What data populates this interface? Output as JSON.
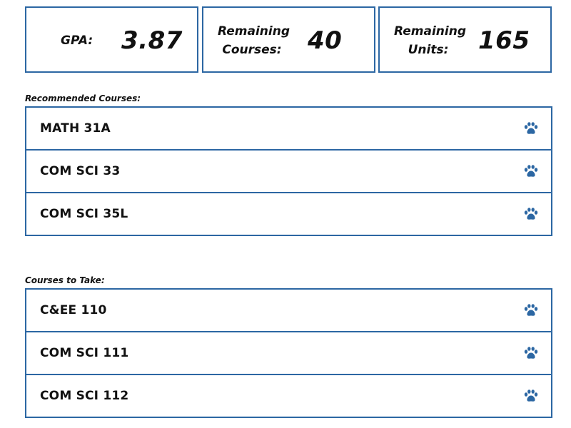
{
  "stats": {
    "gpa": {
      "label": "GPA:",
      "value": "3.87"
    },
    "remaining_courses": {
      "label": "Remaining Courses:",
      "value": "40"
    },
    "remaining_units": {
      "label": "Remaining Units:",
      "value": "165"
    }
  },
  "recommended": {
    "title": "Recommended Courses:",
    "courses": [
      {
        "name": "MATH 31A",
        "icon": "paw-icon"
      },
      {
        "name": "COM SCI 33",
        "icon": "paw-icon"
      },
      {
        "name": "COM SCI 35L",
        "icon": "paw-icon"
      }
    ]
  },
  "to_take": {
    "title": "Courses to Take:",
    "courses": [
      {
        "name": "C&EE 110",
        "icon": "paw-icon"
      },
      {
        "name": "COM SCI 111",
        "icon": "paw-icon"
      },
      {
        "name": "COM SCI 112",
        "icon": "paw-icon"
      }
    ]
  },
  "colors": {
    "accent": "#2c67a3",
    "text": "#111111"
  }
}
